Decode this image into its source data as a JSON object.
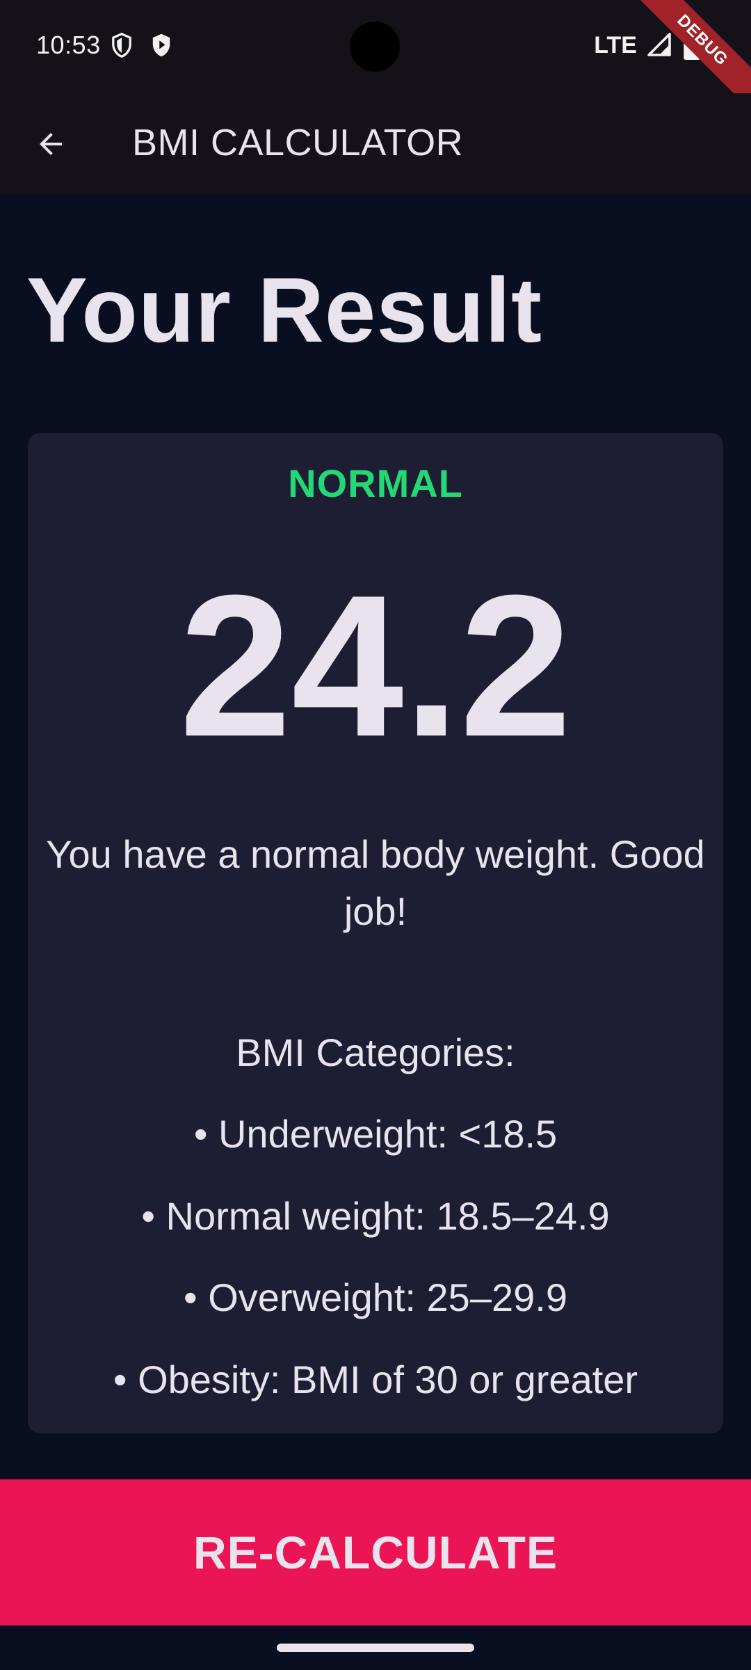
{
  "status_bar": {
    "time": "10:53",
    "network": "LTE",
    "icons": [
      "shield-outline-icon",
      "play-protect-icon",
      "signal-icon",
      "battery-icon"
    ]
  },
  "debug_banner": "DEBUG",
  "app_bar": {
    "back_icon": "arrow-back-icon",
    "title": "BMI CALCULATOR"
  },
  "page": {
    "heading": "Your Result"
  },
  "result": {
    "category": "NORMAL",
    "bmi": "24.2",
    "interpretation": "You have a normal body weight. Good job!",
    "categories_heading": "BMI Categories:",
    "categories": [
      "• Underweight: <18.5",
      "• Normal weight: 18.5–24.9",
      "• Overweight: 25–29.9",
      "• Obesity: BMI of 30 or greater"
    ]
  },
  "actions": {
    "recalculate_label": "RE-CALCULATE"
  },
  "colors": {
    "background": "#0A0E21",
    "header": "#141218",
    "card": "#1D1E33",
    "status_normal": "#24D876",
    "accent": "#EB1555",
    "text": "#E8E3EC"
  }
}
